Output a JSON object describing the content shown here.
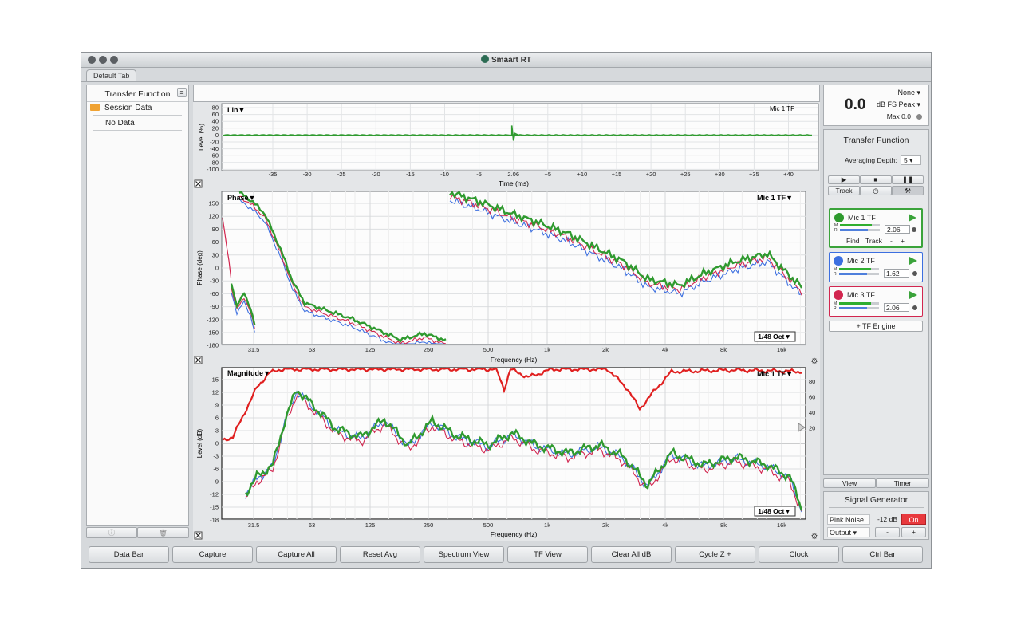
{
  "window": {
    "title": "Smaart RT",
    "tab": "Default Tab"
  },
  "left_panel": {
    "title": "Transfer Function",
    "tree": [
      {
        "label": "Session Data"
      },
      {
        "label": "No Data"
      }
    ]
  },
  "lin_plot": {
    "mode_label": "Lin▼",
    "trace_label": "Mic 1 TF",
    "ylabel": "Level (%)",
    "xlabel": "Time (ms)",
    "y_ticks": [
      "80",
      "60",
      "40",
      "20",
      "0",
      "-20",
      "-40",
      "-60",
      "-80",
      "-100"
    ],
    "x_ticks": [
      "-35",
      "-30",
      "-25",
      "-20",
      "-15",
      "-10",
      "-5",
      "2.06",
      "+5",
      "+10",
      "+15",
      "+20",
      "+25",
      "+30",
      "+35",
      "+40"
    ]
  },
  "phase_plot": {
    "mode_label": "Phase▼",
    "trace_label": "Mic 1 TF▼",
    "smoothing": "1/48 Oct▼",
    "ylabel": "Phase (deg)",
    "xlabel": "Frequency (Hz)",
    "y_ticks": [
      "150",
      "120",
      "90",
      "60",
      "30",
      "0",
      "-30",
      "-60",
      "-90",
      "-120",
      "-150",
      "-180"
    ],
    "x_ticks": [
      "31.5",
      "63",
      "125",
      "250",
      "500",
      "1k",
      "2k",
      "4k",
      "8k",
      "16k"
    ]
  },
  "mag_plot": {
    "mode_label": "Magnitude▼",
    "trace_label": "Mic 1 TF▼",
    "smoothing": "1/48 Oct▼",
    "ylabel": "Level (dB)",
    "xlabel": "Frequency (Hz)",
    "y_ticks": [
      "15",
      "12",
      "9",
      "6",
      "3",
      "0",
      "-3",
      "-6",
      "-9",
      "-12",
      "-15",
      "-18"
    ],
    "coherence_ticks": [
      "80",
      "60",
      "40",
      "20"
    ],
    "x_ticks": [
      "31.5",
      "63",
      "125",
      "250",
      "500",
      "1k",
      "2k",
      "4k",
      "8k",
      "16k"
    ]
  },
  "level_meter": {
    "value": "0.0",
    "source": "None",
    "mode": "dB FS Peak",
    "max": "Max 0.0"
  },
  "tf_panel": {
    "title": "Transfer Function",
    "averaging_label": "Averaging Depth:",
    "averaging_value": "5",
    "track_label": "Track",
    "find_label": "Find",
    "track2_label": "Track",
    "minus": "-",
    "plus": "+",
    "add_engine": "+ TF Engine"
  },
  "measurements": [
    {
      "name": "Mic 1 TF",
      "delay": "2.06",
      "color": "#2f9a2f",
      "active": true
    },
    {
      "name": "Mic 2 TF",
      "delay": "1.62",
      "color": "#3c6fe0",
      "active": false
    },
    {
      "name": "Mic 3 TF",
      "delay": "2.06",
      "color": "#d2264f",
      "active": false
    }
  ],
  "view_tabs": {
    "view": "View",
    "timer": "Timer"
  },
  "signal_generator": {
    "title": "Signal Generator",
    "type": "Pink Noise",
    "level": "-12 dB",
    "state": "On",
    "output": "Output",
    "minus": "-",
    "plus": "+"
  },
  "bottom_bar": [
    "Data Bar",
    "Capture",
    "Capture All",
    "Reset Avg",
    "Spectrum View",
    "TF View",
    "Clear All dB",
    "Cycle Z +",
    "Clock",
    "Ctrl Bar"
  ],
  "colors": {
    "mic1": "#2f9a2f",
    "mic2": "#3c6fe0",
    "mic3": "#d2264f",
    "coherence": "#e02020",
    "on_button": "#e8393d"
  }
}
